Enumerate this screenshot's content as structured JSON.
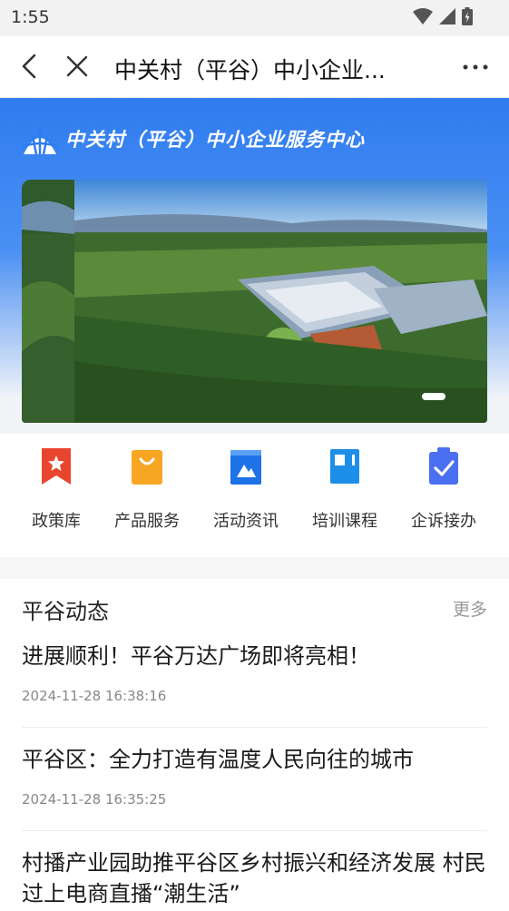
{
  "status": {
    "time": "1:55"
  },
  "nav": {
    "title": "中关村（平谷）中小企业..."
  },
  "hero": {
    "title": "中关村（平谷）中小企业服务中心"
  },
  "menu": {
    "items": [
      {
        "label": "政策库",
        "icon": "bookmark-star-icon",
        "color": "#e8452f"
      },
      {
        "label": "产品服务",
        "icon": "shopping-bag-icon",
        "color": "#f6a623"
      },
      {
        "label": "活动资讯",
        "icon": "calendar-icon",
        "color": "#1e72e8"
      },
      {
        "label": "培训课程",
        "icon": "book-icon",
        "color": "#1e8fe8"
      },
      {
        "label": "企诉接办",
        "icon": "clipboard-check-icon",
        "color": "#4a6ff0"
      }
    ]
  },
  "news": {
    "section_title": "平谷动态",
    "more_label": "更多",
    "items": [
      {
        "headline": "进展顺利！平谷万达广场即将亮相！",
        "time": "2024-11-28 16:38:16"
      },
      {
        "headline": "平谷区：全力打造有温度人民向往的城市",
        "time": "2024-11-28 16:35:25"
      },
      {
        "headline": "村播产业园助推平谷区乡村振兴和经济发展 村民过上电商直播“潮生活”",
        "time": ""
      }
    ]
  },
  "colors": {
    "brand_blue": "#2f7cf0",
    "muted": "#999999"
  }
}
